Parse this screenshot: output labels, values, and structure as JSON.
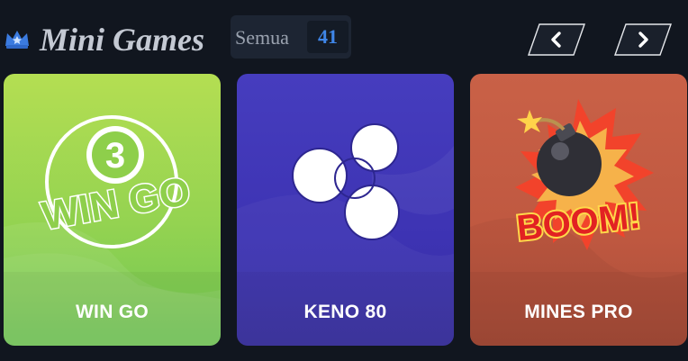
{
  "section": {
    "title": "Mini Games",
    "filter_label": "Semua",
    "count": "41",
    "icon": "crown-icon"
  },
  "navigation": {
    "prev_icon": "chevron-left-icon",
    "next_icon": "chevron-right-icon"
  },
  "games": [
    {
      "name": "WIN GO",
      "art_number": "3",
      "art_text": "WIN GO",
      "color": "#94d351"
    },
    {
      "name": "KENO 80",
      "color": "#3d33b3"
    },
    {
      "name": "MINES PRO",
      "art_text": "BOOM!",
      "color": "#bf5840"
    }
  ],
  "colors": {
    "background": "#11161f",
    "accent": "#3f86e8",
    "title": "#c4c9d3"
  }
}
